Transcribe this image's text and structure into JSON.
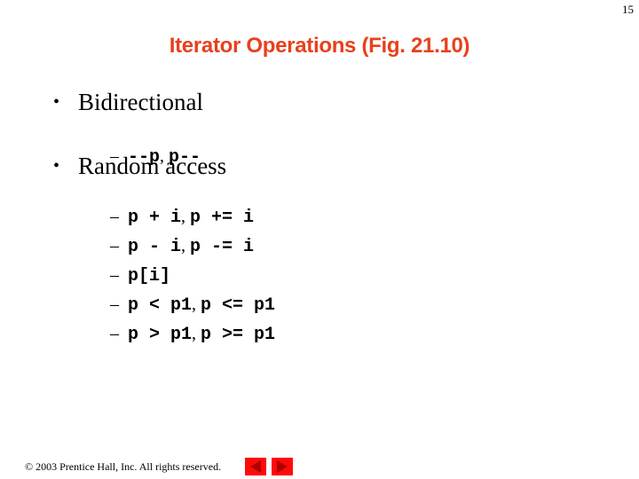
{
  "page_number": "15",
  "title": "Iterator Operations (Fig. 21.10)",
  "bullets": [
    {
      "label": "Bidirectional",
      "items": [
        {
          "dash": "–",
          "parts": [
            "--p",
            ", ",
            "p--"
          ]
        }
      ]
    },
    {
      "label": "Random access",
      "items": [
        {
          "dash": "–",
          "parts": [
            "p + i",
            ", ",
            "p += i"
          ]
        },
        {
          "dash": "–",
          "parts": [
            "p - i",
            ", ",
            "p -= i"
          ]
        },
        {
          "dash": "–",
          "parts": [
            "p[i]"
          ]
        },
        {
          "dash": "–",
          "parts": [
            "p < p1",
            ", ",
            "p <= p1"
          ]
        },
        {
          "dash": "–",
          "parts": [
            "p > p1",
            ", ",
            "p >= p1"
          ]
        }
      ]
    }
  ],
  "bullet_symbol": "•",
  "footer": {
    "copyright": "© 2003 Prentice Hall, Inc.  All rights reserved."
  },
  "nav": {
    "prev_icon": "triangle-left",
    "next_icon": "triangle-right",
    "button_color": "#ff0a0a",
    "arrow_color": "#b00000"
  },
  "colors": {
    "title": "#e8401c",
    "text": "#000000",
    "background": "#ffffff"
  }
}
